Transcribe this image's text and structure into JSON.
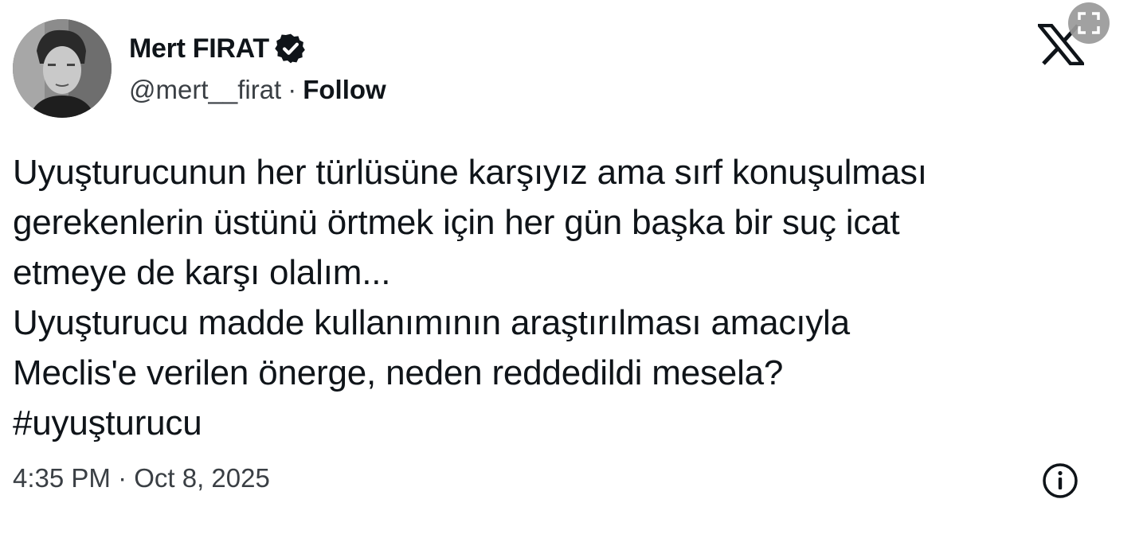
{
  "author": {
    "display_name": "Mert FIRAT",
    "handle": "@mert__firat",
    "separator": "·",
    "follow_label": "Follow",
    "verified": true
  },
  "tweet": {
    "lines": [
      "Uyuşturucunun her türlüsüne karşıyız ama sırf konuşulması",
      "gerekenlerin üstünü örtmek için her gün başka bir suç icat",
      "etmeye de karşı olalım...",
      "Uyuşturucu madde kullanımının araştırılması amacıyla",
      "Meclis'e verilen önerge, neden reddedildi mesela?"
    ],
    "hashtag": "#uyuşturucu"
  },
  "footer": {
    "timestamp": "4:35 PM · Oct 8, 2025"
  },
  "icons": {
    "brand": "x-logo-icon",
    "verified": "verified-badge-icon",
    "info": "info-icon",
    "expand": "expand-icon"
  }
}
